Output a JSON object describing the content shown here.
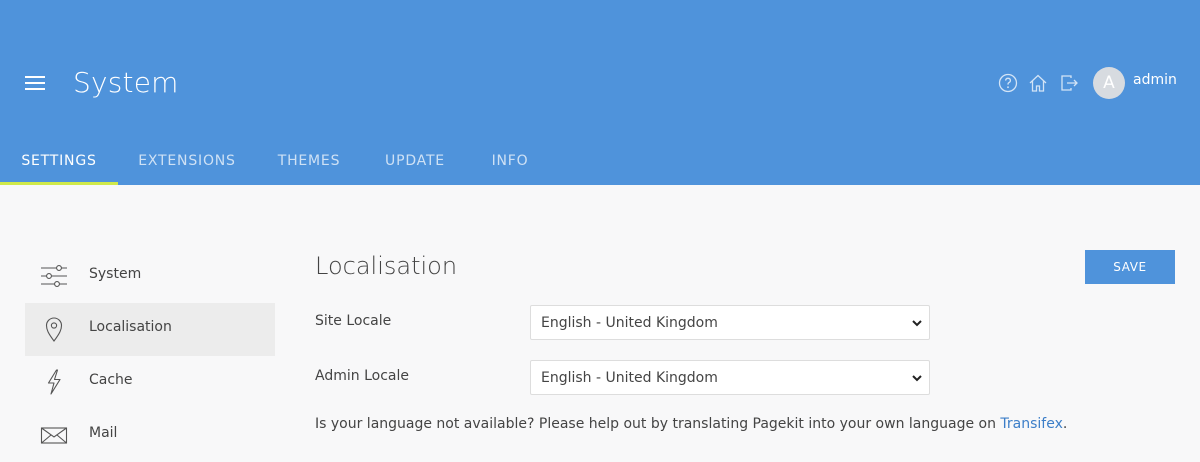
{
  "header": {
    "title": "System",
    "user": {
      "avatar_letter": "A",
      "name": "admin"
    },
    "icons": [
      "help-icon",
      "home-icon",
      "logout-icon"
    ],
    "brand_color": "#4f93db"
  },
  "tabs": [
    {
      "label": "SETTINGS",
      "active": true
    },
    {
      "label": "EXTENSIONS",
      "active": false
    },
    {
      "label": "THEMES",
      "active": false
    },
    {
      "label": "UPDATE",
      "active": false
    },
    {
      "label": "INFO",
      "active": false
    }
  ],
  "sidebar": {
    "items": [
      {
        "label": "System",
        "icon": "sliders-icon",
        "active": false
      },
      {
        "label": "Localisation",
        "icon": "location-pin-icon",
        "active": true
      },
      {
        "label": "Cache",
        "icon": "lightning-icon",
        "active": false
      },
      {
        "label": "Mail",
        "icon": "envelope-icon",
        "active": false
      }
    ]
  },
  "main": {
    "title": "Localisation",
    "save_label": "SAVE",
    "site_locale": {
      "label": "Site Locale",
      "value": "English - United Kingdom"
    },
    "admin_locale": {
      "label": "Admin Locale",
      "value": "English - United Kingdom"
    },
    "help_text": "Is your language not available? Please help out by translating Pagekit into your own language on ",
    "help_link": "Transifex",
    "help_end": "."
  }
}
